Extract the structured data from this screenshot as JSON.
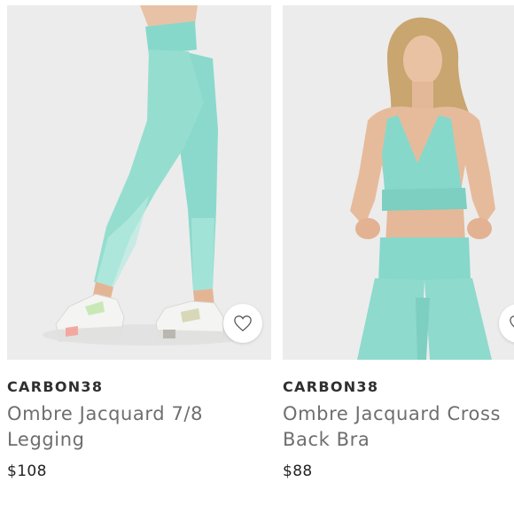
{
  "products": [
    {
      "brand": "CARBON38",
      "name": "Ombre Jacquard 7/8 Legging",
      "price": "$108",
      "image_alt": "heart-icon",
      "icon": "heart-outline"
    },
    {
      "brand": "CARBON38",
      "name": "Ombre Jacquard Cross Back Bra",
      "price": "$88",
      "icon": "heart-outline"
    }
  ],
  "colors": {
    "mint": "#8fdbcf",
    "mint_dark": "#6fc8bb",
    "background": "#ececec",
    "text_brand": "#2f2f2f",
    "text_name": "#6e6e6e"
  }
}
